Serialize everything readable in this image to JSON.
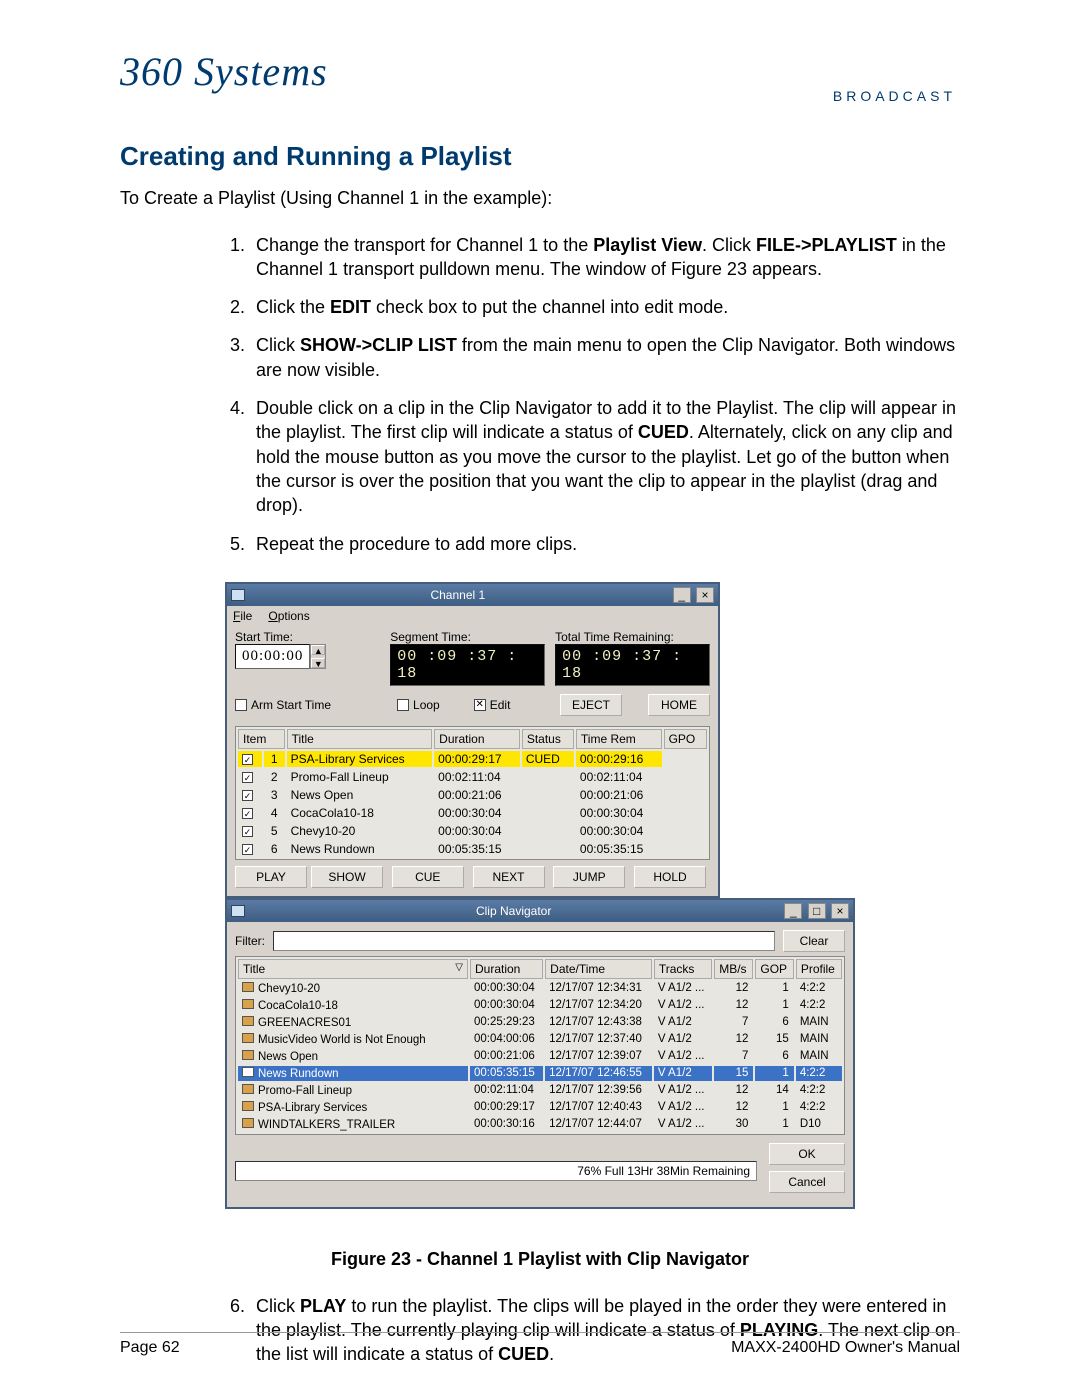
{
  "logo": {
    "main": "360 Systems",
    "sub": "BROADCAST"
  },
  "heading": "Creating and Running a Playlist",
  "intro": "To Create a Playlist (Using Channel 1 in the example):",
  "steps": {
    "s1_a": "Change the transport for Channel 1 to the ",
    "s1_b": "Playlist View",
    "s1_c": ". Click ",
    "s1_d": "FILE->PLAYLIST",
    "s1_e": " in the Channel 1 transport pulldown menu. The window of Figure 23 appears.",
    "s2_a": "Click the ",
    "s2_b": "EDIT",
    "s2_c": " check box to put the channel into edit mode.",
    "s3_a": "Click ",
    "s3_b": "SHOW->CLIP LIST",
    "s3_c": " from the main menu to open the Clip Navigator. Both windows are now visible.",
    "s4_a": "Double click on a clip in the Clip Navigator to add it to the Playlist. The clip will appear in the playlist. The first clip will indicate a status of ",
    "s4_b": "CUED",
    "s4_c": ".  Alternately, click on any clip and hold the mouse button as you move the cursor to the playlist.  Let go of the button when the cursor is over the position that you want the clip to appear in the playlist (drag and drop).",
    "s5": "Repeat the procedure to add more clips.",
    "s6_a": "Click ",
    "s6_b": "PLAY",
    "s6_c": " to run the playlist. The clips will be played in the order they were entered in the playlist. The currently playing clip will indicate a status of ",
    "s6_d": "PLAYING",
    "s6_e": ". The next clip on the list will indicate a status of ",
    "s6_f": "CUED",
    "s6_g": "."
  },
  "caption": "Figure 23 - Channel 1 Playlist with Clip Navigator",
  "footer": {
    "left": "Page 62",
    "right": "MAXX-2400HD Owner's Manual"
  },
  "channel_window": {
    "title": "Channel  1",
    "menu": {
      "file": "File",
      "options": "Options"
    },
    "labels": {
      "start": "Start Time:",
      "segment": "Segment Time:",
      "total": "Total Time Remaining:"
    },
    "times": {
      "start": "00:00:00",
      "segment": "00 :09 :37 : 18",
      "total": "00 :09 :37 : 18"
    },
    "checks": {
      "arm": "Arm Start Time",
      "loop": "Loop",
      "edit": "Edit"
    },
    "check_state": {
      "arm": "",
      "loop": "",
      "edit": "✕"
    },
    "btns": {
      "eject": "EJECT",
      "home": "HOME",
      "play": "PLAY",
      "show": "SHOW",
      "cue": "CUE",
      "next": "NEXT",
      "jump": "JUMP",
      "hold": "HOLD"
    },
    "headers": [
      "Item",
      "Title",
      "Duration",
      "Status",
      "Time Rem",
      "GPO"
    ],
    "rows": [
      {
        "chk": "✓",
        "num": "1",
        "title": "PSA-Library Services",
        "dur": "00:00:29:17",
        "status": "CUED",
        "rem": "00:00:29:16",
        "cued": true
      },
      {
        "chk": "✓",
        "num": "2",
        "title": "Promo-Fall Lineup",
        "dur": "00:02:11:04",
        "status": "",
        "rem": "00:02:11:04"
      },
      {
        "chk": "✓",
        "num": "3",
        "title": "News Open",
        "dur": "00:00:21:06",
        "status": "",
        "rem": "00:00:21:06"
      },
      {
        "chk": "✓",
        "num": "4",
        "title": "CocaCola10-18",
        "dur": "00:00:30:04",
        "status": "",
        "rem": "00:00:30:04"
      },
      {
        "chk": "✓",
        "num": "5",
        "title": "Chevy10-20",
        "dur": "00:00:30:04",
        "status": "",
        "rem": "00:00:30:04"
      },
      {
        "chk": "✓",
        "num": "6",
        "title": "News Rundown",
        "dur": "00:05:35:15",
        "status": "",
        "rem": "00:05:35:15"
      }
    ]
  },
  "clip_navigator": {
    "title": "Clip Navigator",
    "filter_label": "Filter:",
    "clear": "Clear",
    "headers": [
      "Title",
      "Duration",
      "Date/Time",
      "Tracks",
      "MB/s",
      "GOP",
      "Profile"
    ],
    "rows": [
      {
        "t": "Chevy10-20",
        "d": "00:00:30:04",
        "dt": "12/17/07 12:34:31",
        "tr": "V A1/2 ...",
        "mb": "12",
        "g": "1",
        "p": "4:2:2"
      },
      {
        "t": "CocaCola10-18",
        "d": "00:00:30:04",
        "dt": "12/17/07 12:34:20",
        "tr": "V A1/2 ...",
        "mb": "12",
        "g": "1",
        "p": "4:2:2"
      },
      {
        "t": "GREENACRES01",
        "d": "00:25:29:23",
        "dt": "12/17/07 12:43:38",
        "tr": "V A1/2",
        "mb": "7",
        "g": "6",
        "p": "MAIN"
      },
      {
        "t": "MusicVideo World is Not Enough",
        "d": "00:04:00:06",
        "dt": "12/17/07 12:37:40",
        "tr": "V A1/2",
        "mb": "12",
        "g": "15",
        "p": "MAIN"
      },
      {
        "t": "News Open",
        "d": "00:00:21:06",
        "dt": "12/17/07 12:39:07",
        "tr": "V A1/2 ...",
        "mb": "7",
        "g": "6",
        "p": "MAIN"
      },
      {
        "t": "News Rundown",
        "d": "00:05:35:15",
        "dt": "12/17/07 12:46:55",
        "tr": "V A1/2",
        "mb": "15",
        "g": "1",
        "p": "4:2:2",
        "sel": true
      },
      {
        "t": "Promo-Fall Lineup",
        "d": "00:02:11:04",
        "dt": "12/17/07 12:39:56",
        "tr": "V A1/2 ...",
        "mb": "12",
        "g": "14",
        "p": "4:2:2"
      },
      {
        "t": "PSA-Library Services",
        "d": "00:00:29:17",
        "dt": "12/17/07 12:40:43",
        "tr": "V A1/2 ...",
        "mb": "12",
        "g": "1",
        "p": "4:2:2"
      },
      {
        "t": "WINDTALKERS_TRAILER",
        "d": "00:00:30:16",
        "dt": "12/17/07 12:44:07",
        "tr": "V A1/2 ...",
        "mb": "30",
        "g": "1",
        "p": "D10"
      }
    ],
    "status": "76% Full  13Hr 38Min Remaining",
    "ok": "OK",
    "cancel": "Cancel"
  }
}
